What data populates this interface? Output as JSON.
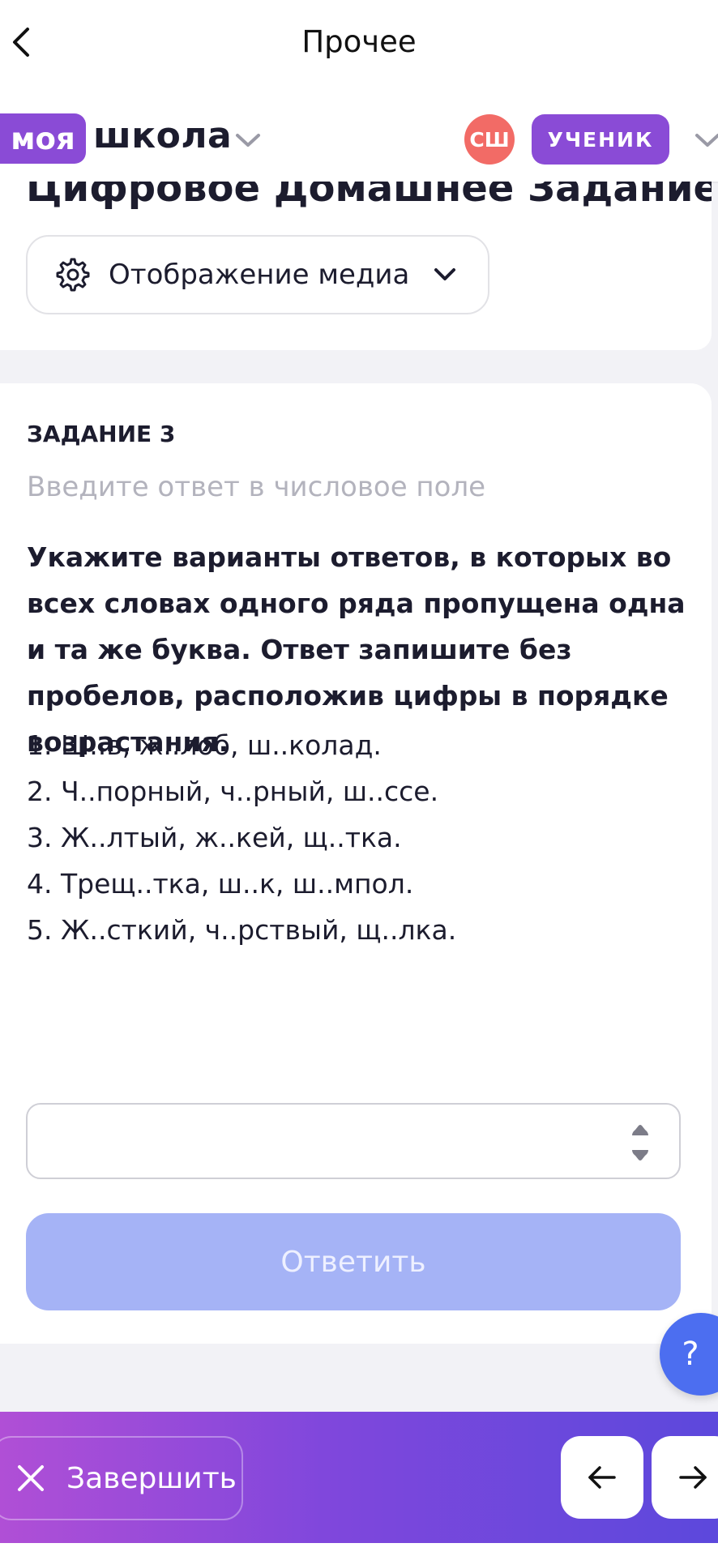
{
  "topbar": {
    "title": "Прочее"
  },
  "header": {
    "logo_part1": "моя",
    "logo_part2": "школа",
    "avatar_initials": "СШ",
    "role": "УЧЕНИК"
  },
  "page": {
    "heading": "Цифровое Домашнее Задание",
    "media_label": "Отображение медиа"
  },
  "task": {
    "number_label": "ЗАДАНИЕ 3",
    "hint": "Введите ответ в числовое поле",
    "question": "Укажите варианты ответов, в которых во всех словах одного ряда пропущена одна и та же буква. Ответ запишите без пробелов, расположив цифры в порядке возрастания.",
    "options": [
      "1. Ш..в, ж..лоб, ш..колад.",
      "2. Ч..порный, ч..рный, ш..ссе.",
      "3. Ж..лтый, ж..кей, щ..тка.",
      "4. Трещ..тка, ш..к, ш..мпол.",
      "5. Ж..сткий, ч..рствый, щ..лка."
    ],
    "answer_value": "",
    "submit_label": "Ответить"
  },
  "help": {
    "label": "?"
  },
  "footer": {
    "finish_label": "Завершить"
  },
  "colors": {
    "brand_purple": "#8a4bd6",
    "avatar_red": "#f26b66",
    "submit_disabled": "#a5b3f6",
    "help_blue": "#4c6ef0"
  },
  "icons": {
    "back": "chevron-left-icon",
    "school_dropdown": "chevron-down-icon",
    "role_dropdown": "chevron-down-icon",
    "media_settings": "gear-icon",
    "media_dropdown": "chevron-down-icon",
    "stepper": "stepper-arrows-icon",
    "finish": "close-icon",
    "prev": "arrow-left-icon",
    "next": "arrow-right-icon"
  }
}
